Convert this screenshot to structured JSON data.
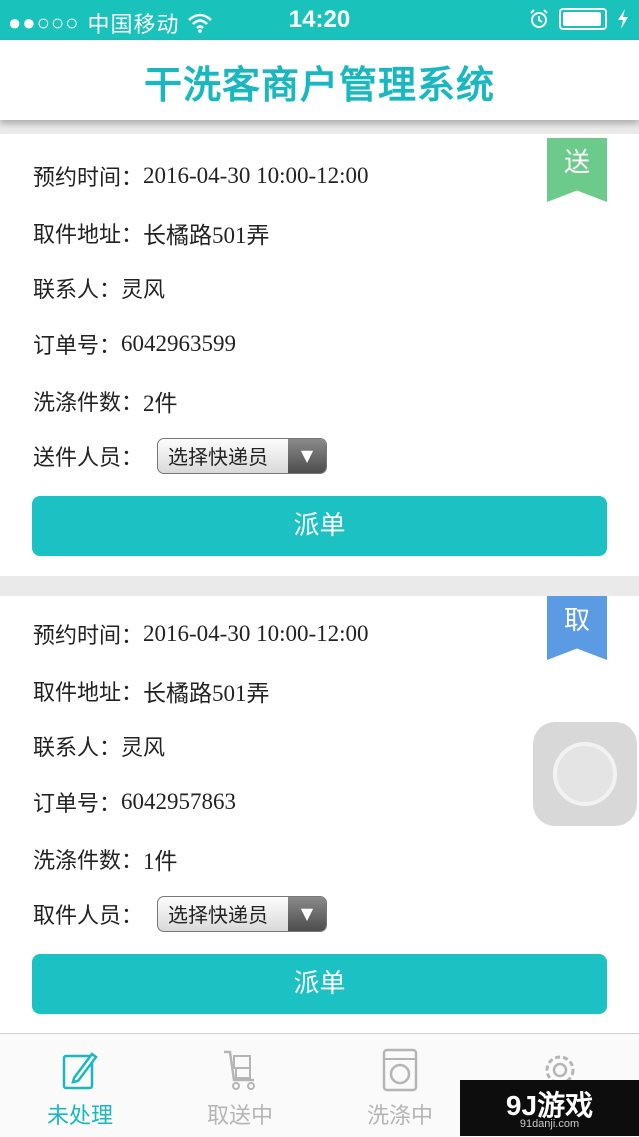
{
  "status_bar": {
    "signal": "●●○○○",
    "carrier": "中国移动",
    "wifi_icon": "wifi-icon",
    "time": "14:20",
    "alarm_icon": "alarm-icon",
    "battery_icon": "battery-icon",
    "charging_icon": "charging-icon"
  },
  "header": {
    "title": "干洗客商户管理系统"
  },
  "orders": [
    {
      "badge": "送",
      "badge_color": "#6ccb8a",
      "time_label": "预约时间：",
      "time_value": "2016-04-30 10:00-12:00",
      "address_label": "取件地址：",
      "address_value": "长橘路501弄",
      "contact_label": "联系人：",
      "contact_value": "灵风",
      "order_label": "订单号：",
      "order_value": "6042963599",
      "count_label": "洗涤件数：",
      "count_value": "2件",
      "courier_label": "送件人员：",
      "courier_select": "选择快递员",
      "dispatch_label": "派单"
    },
    {
      "badge": "取",
      "badge_color": "#5a9be4",
      "time_label": "预约时间：",
      "time_value": "2016-04-30 10:00-12:00",
      "address_label": "取件地址：",
      "address_value": "长橘路501弄",
      "contact_label": "联系人：",
      "contact_value": "灵风",
      "order_label": "订单号：",
      "order_value": "6042957863",
      "count_label": "洗涤件数：",
      "count_value": "1件",
      "courier_label": "取件人员：",
      "courier_select": "选择快递员",
      "dispatch_label": "派单"
    }
  ],
  "tabs": [
    {
      "label": "未处理",
      "icon": "edit-icon",
      "active": true
    },
    {
      "label": "取送中",
      "icon": "cart-icon",
      "active": false
    },
    {
      "label": "洗涤中",
      "icon": "washer-icon",
      "active": false
    },
    {
      "label": "",
      "icon": "gear-icon",
      "active": false
    }
  ],
  "accent_color": "#19b8c0",
  "watermark": {
    "main": "9J游戏",
    "sub": "91danji.com"
  }
}
